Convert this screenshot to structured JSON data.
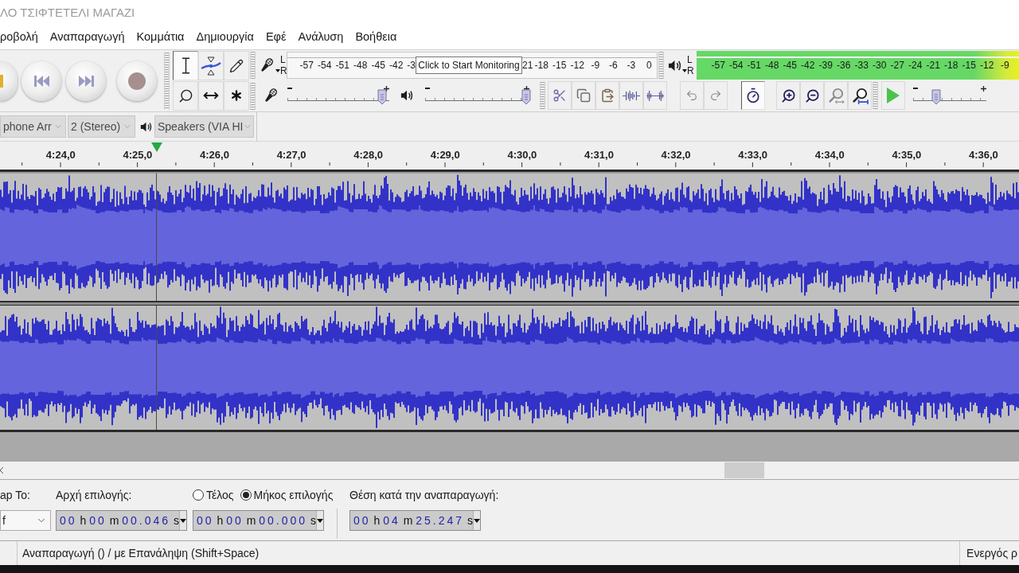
{
  "window": {
    "title": "ΛΟ ΤΣΙΦΤΕΤΕΛΙ ΜΑΓΑΖΙ"
  },
  "menu": [
    {
      "label": "ροβολή"
    },
    {
      "label": "Αναπαραγωγή"
    },
    {
      "label": "Κομμάτια"
    },
    {
      "label": "Δημιουργία"
    },
    {
      "label": "Εφέ"
    },
    {
      "label": "Ανάλυση"
    },
    {
      "label": "Βοήθεια"
    }
  ],
  "tools": [
    {
      "selected": true
    },
    {
      "selected": false
    },
    {
      "selected": false
    },
    {
      "selected": false
    },
    {
      "selected": false
    },
    {
      "selected": false
    }
  ],
  "record_meter": {
    "channels": [
      "L",
      "R"
    ],
    "scale_before": [
      "-57",
      "-54",
      "-51",
      "-48",
      "-45",
      "-42",
      "-3"
    ],
    "tooltip": "Click to Start Monitoring",
    "scale_after": [
      "21",
      "-18",
      "-15",
      "-12",
      "-9",
      "-6",
      "-3",
      "0"
    ]
  },
  "playback_meter": {
    "channels": [
      "L",
      "R"
    ],
    "scale": [
      "-57",
      "-54",
      "-51",
      "-48",
      "-45",
      "-42",
      "-39",
      "-36",
      "-33",
      "-30",
      "-27",
      "-24",
      "-21",
      "-18",
      "-15",
      "-12",
      "-9"
    ]
  },
  "mixer": {
    "record_volume": {
      "level": 0.96
    },
    "playback_volume": {
      "level": 1
    }
  },
  "edit_toolbar": {
    "sync_lock": {
      "on": true
    }
  },
  "play_at_speed": {
    "level": 0.3
  },
  "devices": [
    {
      "value": "phone Arr"
    },
    {
      "value": "2 (Stereo)"
    },
    {
      "value": "Speakers (VIA HI"
    }
  ],
  "ruler": {
    "labels": [
      "4:24,0",
      "4:25,0",
      "4:26,0",
      "4:27,0",
      "4:28,0",
      "4:29,0",
      "4:30,0",
      "4:31,0",
      "4:32,0",
      "4:33,0",
      "4:34,0",
      "4:35,0",
      "4:36,0"
    ]
  },
  "selection_toolbar": {
    "snap_label": "ap To:",
    "snap_value": "f",
    "start_label": "Αρχή επιλογής:",
    "start_value": "00 h 00 m 00.046 s",
    "end_options": [
      {
        "label": "Τέλος",
        "selected": false
      },
      {
        "label": "Μήκος επιλογής",
        "selected": true
      }
    ],
    "end_value": "00 h 00 m 00.000 s",
    "position_label": "Θέση κατά την αναπαραγωγή:",
    "position_value": "00 h 04 m 25.247 s"
  },
  "status_bar": {
    "message": "Αναπαραγωγή () / με Επανάληψη (Shift+Space)",
    "right": "Ενεργός ρ"
  }
}
